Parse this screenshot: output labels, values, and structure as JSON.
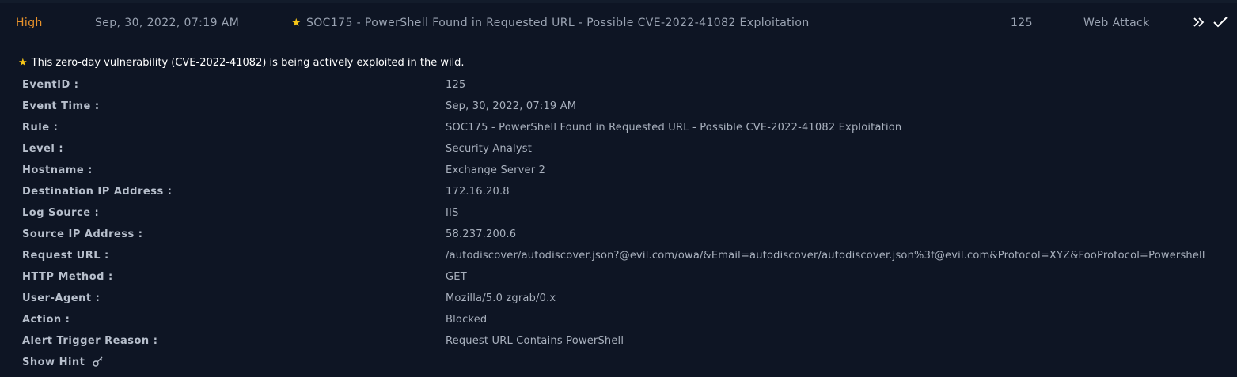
{
  "alert": {
    "severity": "High",
    "date": "Sep, 30, 2022, 07:19 AM",
    "rule": "SOC175 - PowerShell Found in Requested URL - Possible CVE-2022-41082 Exploitation",
    "event_id": "125",
    "type": "Web Attack",
    "severity_color": "#e8922b",
    "star_color": "#f5c518",
    "action_icons": [
      "double-chevron-right-icon",
      "check-icon"
    ]
  },
  "detail": {
    "note": "This zero-day vulnerability (CVE-2022-41082) is being actively exploited in the wild.",
    "fields": [
      {
        "label": "EventID :",
        "value": "125"
      },
      {
        "label": "Event Time :",
        "value": "Sep, 30, 2022, 07:19 AM"
      },
      {
        "label": "Rule :",
        "value": "SOC175 - PowerShell Found in Requested URL - Possible CVE-2022-41082 Exploitation"
      },
      {
        "label": "Level :",
        "value": "Security Analyst"
      },
      {
        "label": "Hostname :",
        "value": "Exchange Server 2"
      },
      {
        "label": "Destination IP Address :",
        "value": "172.16.20.8"
      },
      {
        "label": "Log Source :",
        "value": "IIS"
      },
      {
        "label": "Source IP Address :",
        "value": "58.237.200.6"
      },
      {
        "label": "Request URL :",
        "value": "/autodiscover/autodiscover.json?@evil.com/owa/&Email=autodiscover/autodiscover.json%3f@evil.com&Protocol=XYZ&FooProtocol=Powershell"
      },
      {
        "label": "HTTP Method :",
        "value": "GET"
      },
      {
        "label": "User-Agent :",
        "value": "Mozilla/5.0 zgrab/0.x"
      },
      {
        "label": "Action :",
        "value": "Blocked"
      },
      {
        "label": "Alert Trigger Reason :",
        "value": "Request URL Contains PowerShell"
      }
    ],
    "hint_label": "Show Hint"
  }
}
